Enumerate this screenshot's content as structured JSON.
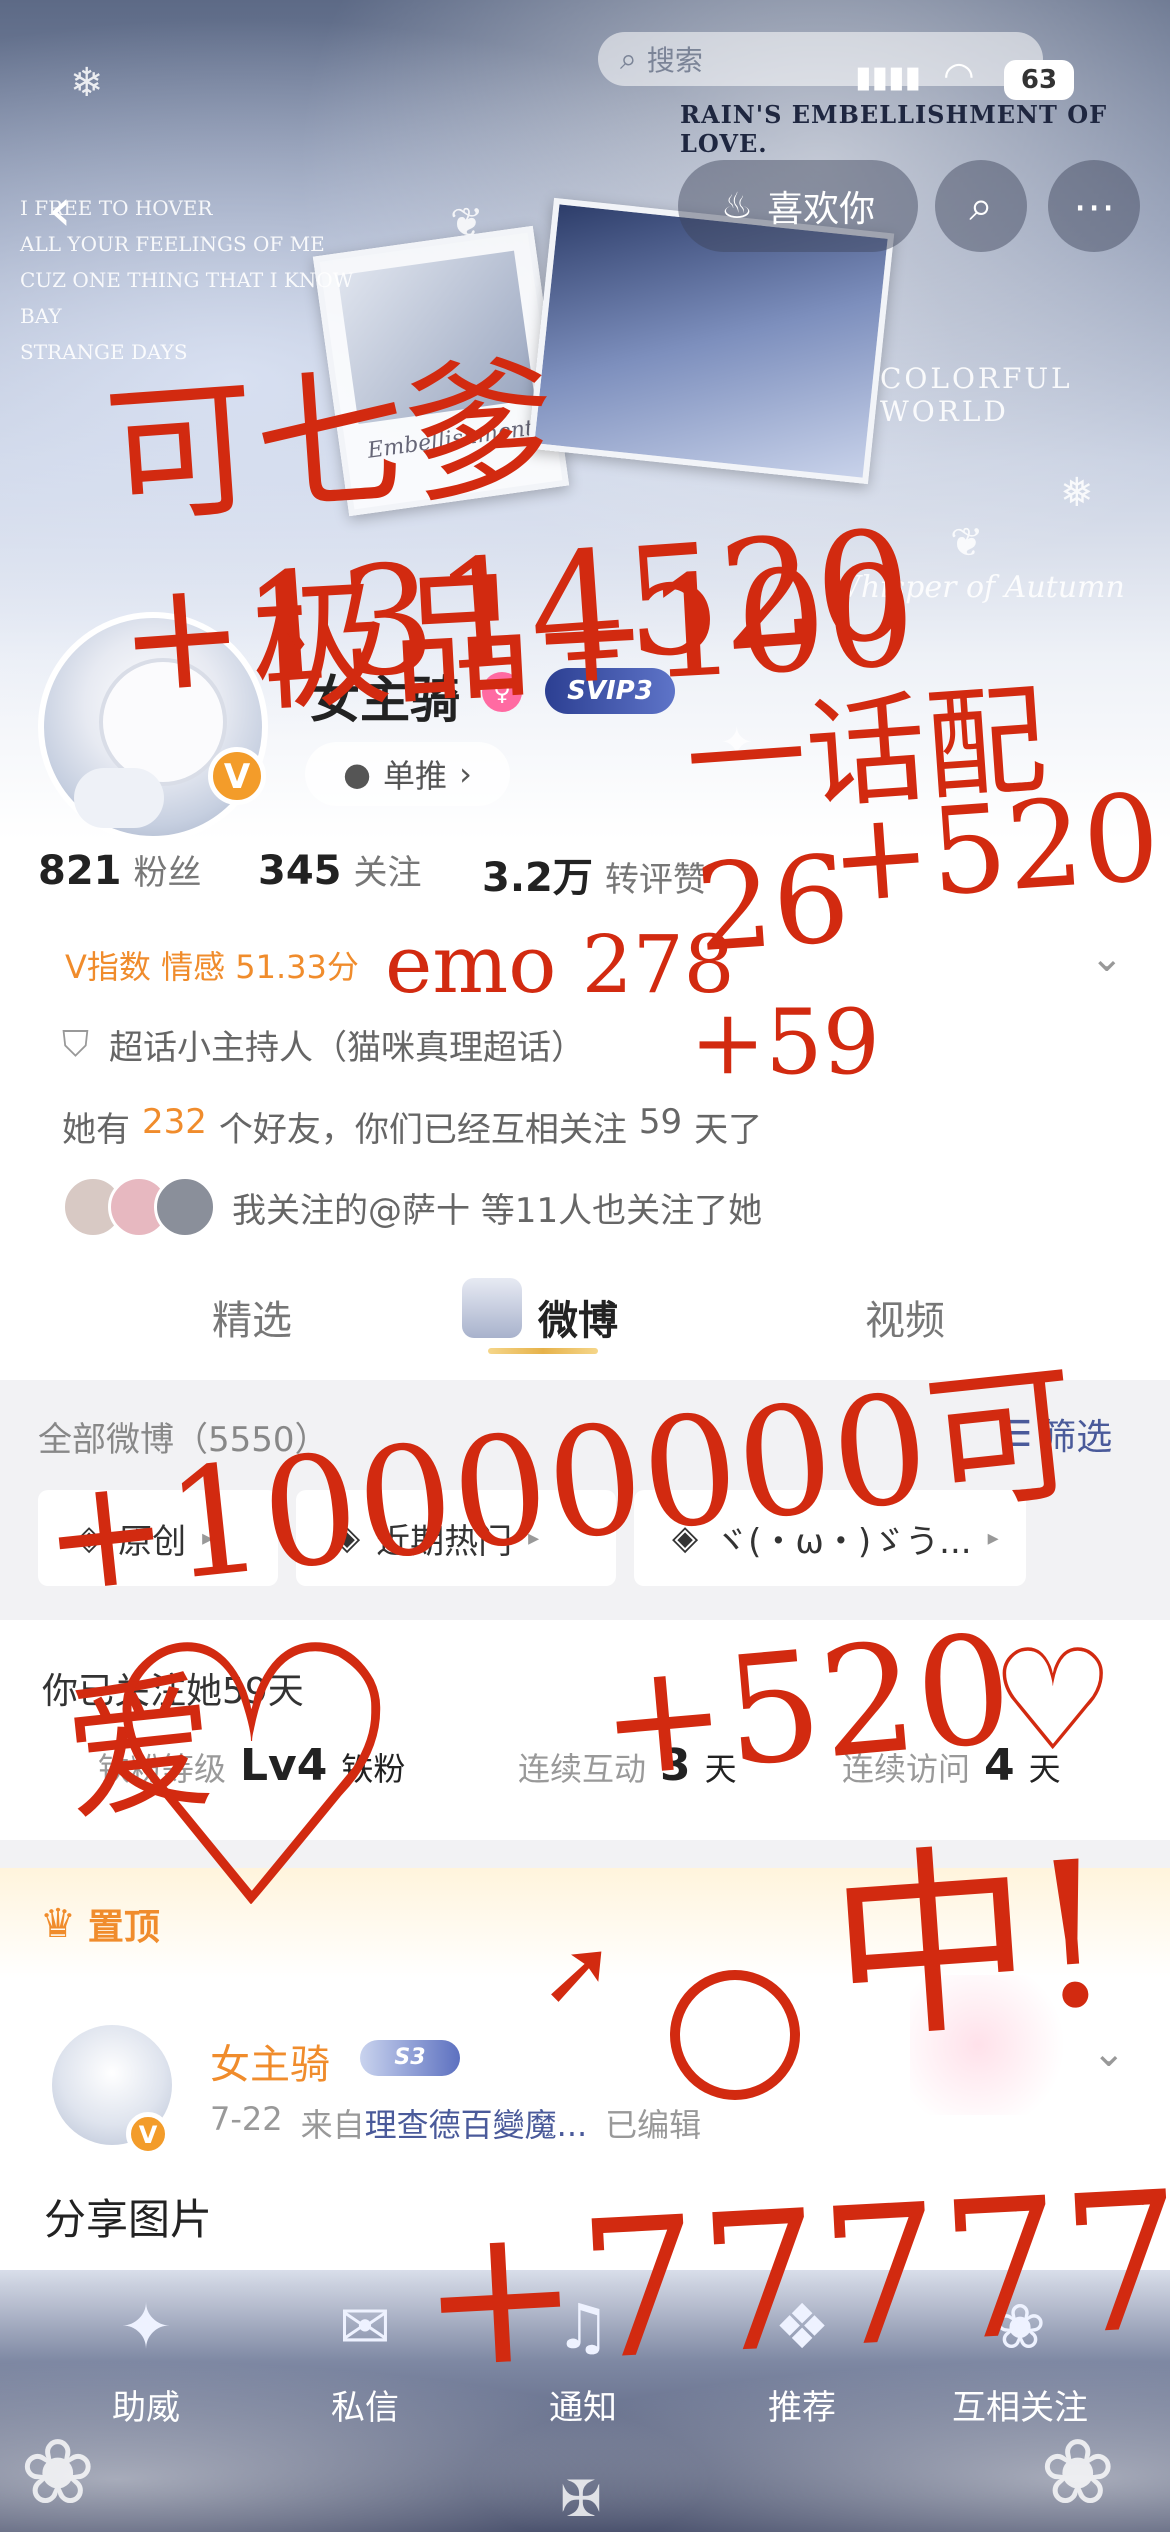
{
  "status_bar": {
    "battery": "63"
  },
  "search": {
    "placeholder": "搜索"
  },
  "banner": {
    "headline": "RAIN'S EMBELLISHMENT OF LOVE.",
    "poem": [
      "I FREE TO HOVER",
      "ALL YOUR FEELINGS OF ME",
      "CUZ ONE THING THAT I KNOW",
      "BAY",
      "STRANGE DAYS"
    ],
    "card_text": "Embellishment",
    "side_text": "Whisper of Autumn",
    "world_text": "COLORFUL WORLD"
  },
  "header": {
    "like_label": "喜欢你"
  },
  "profile": {
    "username": "女主骑",
    "svip": "SVIP3",
    "fan_label": "单推",
    "stats": [
      {
        "num": "821",
        "label": "粉丝"
      },
      {
        "num": "345",
        "label": "关注"
      },
      {
        "num": "3.2万",
        "label": "转评赞"
      }
    ],
    "v_index": "V指数 情感 51.33分",
    "title": "超话小主持人（猫咪真理超话）",
    "friends_prefix": "她有",
    "friends_count": "232",
    "friends_suffix": "个好友，你们已经互相关注",
    "mutual_days": "59",
    "mutual_unit": "天了",
    "followed_by": "我关注的@萨十 等11人也关注了她"
  },
  "tabs": [
    "精选",
    "微博",
    "视频"
  ],
  "feed_header": {
    "label": "全部微博（5550）",
    "filter": "筛选"
  },
  "filters": [
    "原创",
    "近期热门",
    "ヾ(・ω・)ゞう..."
  ],
  "fan_card": {
    "followed": "你已关注她59天",
    "items": [
      {
        "label": "铁粉等级",
        "value": "Lv4",
        "unit": "铁粉"
      },
      {
        "label": "连续互动",
        "value": "3",
        "unit": "天"
      },
      {
        "label": "连续访问",
        "value": "4",
        "unit": "天"
      }
    ]
  },
  "pinned": {
    "label": "置顶"
  },
  "post": {
    "author": "女主骑",
    "badge": "S3",
    "date": "7-22",
    "source_prefix": "来自",
    "source": "理查德百變魔...",
    "edited": "已编辑",
    "content": "分享图片"
  },
  "bottom_bar": [
    "助威",
    "私信",
    "通知",
    "推荐",
    "互相关注"
  ],
  "handwriting": {
    "line1": "可七爹+1314520",
    "line2": "极品+100",
    "line3": "一话配26",
    "line4": "+520",
    "line5": "emo 278",
    "line6": "+59",
    "line7": "+10000000可爱",
    "line8": "+520",
    "line9": "中!",
    "line10": "+77777"
  },
  "colors": {
    "accent": "#f08c2c",
    "ink": "#d22a10",
    "link": "#4a5a9a"
  }
}
